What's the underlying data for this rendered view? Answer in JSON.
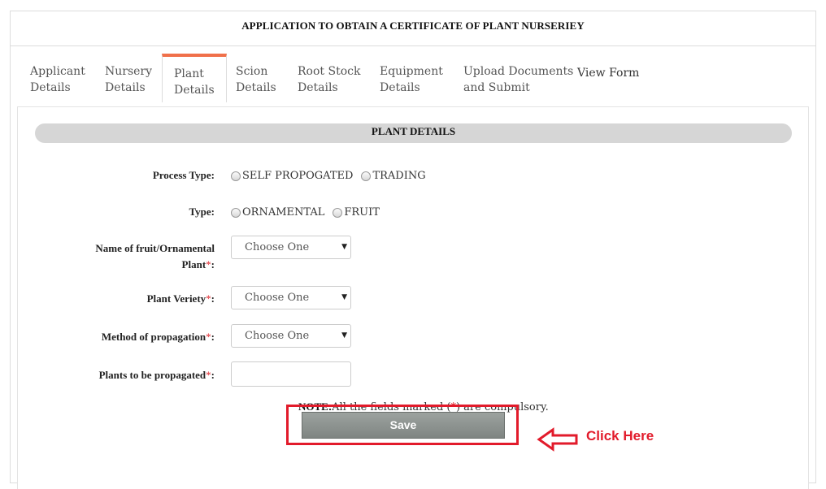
{
  "form": {
    "title": "APPLICATION TO OBTAIN A CERTIFICATE OF PLANT NURSERIEY"
  },
  "tabs": [
    {
      "line1": "Applicant",
      "line2": "Details"
    },
    {
      "line1": "Nursery",
      "line2": "Details"
    },
    {
      "line1": "Plant",
      "line2": "Details"
    },
    {
      "line1": "Scion",
      "line2": "Details"
    },
    {
      "line1": "Root Stock",
      "line2": "Details"
    },
    {
      "line1": "Equipment",
      "line2": "Details"
    },
    {
      "line1": "Upload Documents",
      "line2": "and Submit"
    },
    {
      "line1": "View Form",
      "line2": ""
    }
  ],
  "active_tab": "Plant Details",
  "section": {
    "title": "PLANT DETAILS"
  },
  "fields": {
    "process_type": {
      "label": "Process Type:",
      "options": [
        "SELF PROPOGATED",
        "TRADING"
      ]
    },
    "type": {
      "label": "Type:",
      "options": [
        "ORNAMENTAL",
        "FRUIT"
      ]
    },
    "plant_name": {
      "label_line1": "Name of fruit/Ornamental",
      "label_line2": "Plant",
      "required_mark": "*",
      "colon": ":",
      "value": "Choose One"
    },
    "plant_variety": {
      "label": "Plant Veriety",
      "required_mark": "*",
      "colon": ":",
      "value": "Choose One"
    },
    "propagation_method": {
      "label": "Method of propagation",
      "required_mark": "*",
      "colon": ":",
      "value": "Choose One"
    },
    "plants_count": {
      "label": "Plants to be propagated",
      "required_mark": "*",
      "colon": ":",
      "value": ""
    }
  },
  "note": {
    "bold": "NOTE:",
    "text_before": "All the fields marked (",
    "mark": "*",
    "text_after": ") are compulsory."
  },
  "actions": {
    "save_label": "Save"
  },
  "annotation": {
    "text": "Click Here",
    "color": "#e21b2b"
  },
  "colors": {
    "accent_tab": "#f0704a",
    "required": "#e0262d",
    "save_button": "#8f9592"
  },
  "icons": {
    "dropdown": "caret-down-icon",
    "annotation_arrow": "left-arrow-icon"
  }
}
